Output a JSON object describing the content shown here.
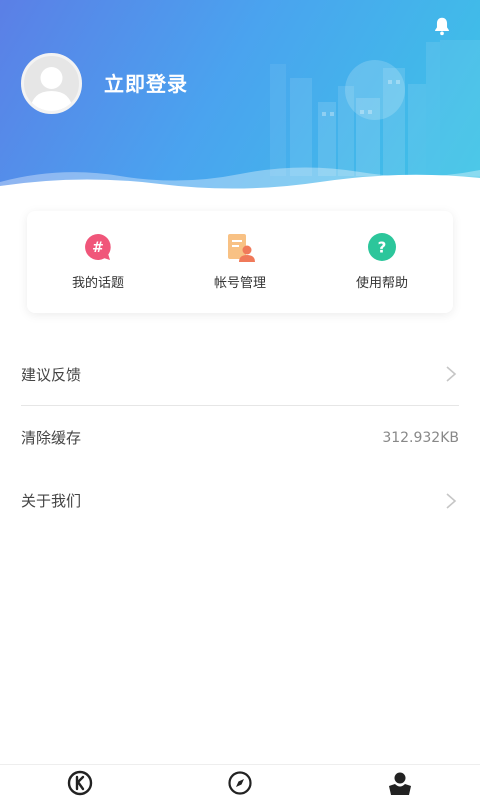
{
  "header": {
    "login_label": "立即登录",
    "icons": {
      "notification": "bell-icon",
      "avatar": "avatar-placeholder-icon"
    }
  },
  "quick_actions": [
    {
      "label": "我的话题",
      "icon": "hashtag-chat-icon",
      "color": "#f0567a"
    },
    {
      "label": "帐号管理",
      "icon": "account-card-icon",
      "color": "#f4a35c"
    },
    {
      "label": "使用帮助",
      "icon": "help-question-icon",
      "color": "#2cc69b"
    }
  ],
  "settings": [
    {
      "label": "建议反馈",
      "value": ""
    },
    {
      "label": "清除缓存",
      "value": "312.932KB"
    },
    {
      "label": "关于我们",
      "value": ""
    }
  ],
  "bottom_nav": [
    {
      "icon": "k-logo-icon",
      "active": false
    },
    {
      "icon": "compass-icon",
      "active": false
    },
    {
      "icon": "profile-icon",
      "active": true
    }
  ],
  "colors": {
    "header_gradient_start": "#5b7fe6",
    "header_gradient_end": "#3cc6e6",
    "text_primary": "#333333",
    "text_secondary": "#888888"
  }
}
